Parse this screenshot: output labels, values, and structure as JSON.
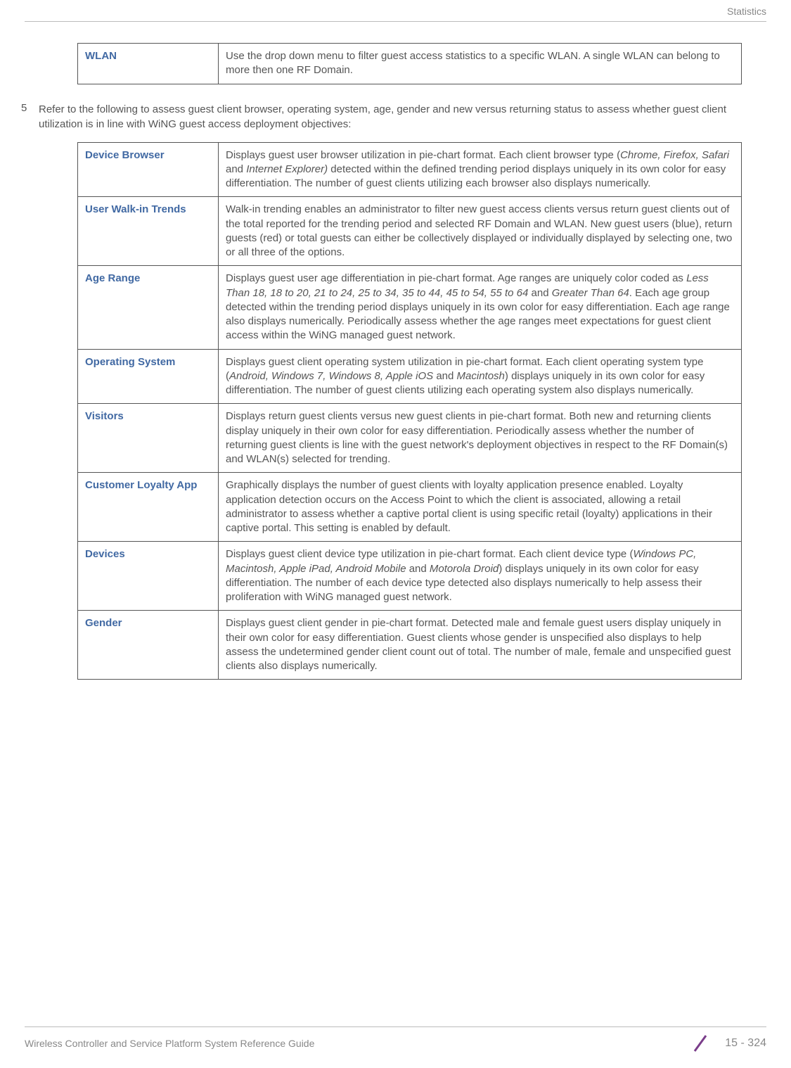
{
  "header": {
    "section": "Statistics"
  },
  "table1": {
    "rows": [
      {
        "label": "WLAN",
        "desc": "Use the drop down menu to filter guest access statistics to a specific WLAN. A single WLAN can belong to more then one RF Domain."
      }
    ]
  },
  "step": {
    "number": "5",
    "text": "Refer to the following to assess guest client browser, operating system, age, gender and new versus returning status to assess whether guest client utilization is in line with WiNG guest access deployment objectives:"
  },
  "table2": {
    "rows": [
      {
        "label": "Device Browser",
        "desc_parts": [
          {
            "t": "Displays guest user browser utilization in pie-chart format. Each client browser type ("
          },
          {
            "t": "Chrome, Firefox, Safari",
            "i": true
          },
          {
            "t": " and "
          },
          {
            "t": "Internet Explorer)",
            "i": true
          },
          {
            "t": " detected within the defined trending period displays uniquely in its own color for easy differentiation. The number of guest clients utilizing each browser also displays numerically."
          }
        ]
      },
      {
        "label": "User Walk-in Trends",
        "desc_parts": [
          {
            "t": "Walk-in trending enables an administrator to filter new guest access clients versus return guest clients out of the total reported for the trending period and selected RF Domain and WLAN. New guest users (blue), return guests (red) or total guests can either be collectively displayed or individually displayed by selecting one, two or all three of the options."
          }
        ]
      },
      {
        "label": "Age Range",
        "desc_parts": [
          {
            "t": "Displays guest user age differentiation in pie-chart format. Age ranges are uniquely color coded as "
          },
          {
            "t": "Less Than 18, 18 to 20, 21 to 24, 25 to 34, 35 to 44, 45 to 54, 55 to 64",
            "i": true
          },
          {
            "t": " and "
          },
          {
            "t": "Greater Than 64",
            "i": true
          },
          {
            "t": ". Each age group detected within the trending period displays uniquely in its own color for easy differentiation. Each age range also displays numerically. Periodically assess whether the age ranges meet expectations for guest client access within the WiNG managed guest network."
          }
        ]
      },
      {
        "label": "Operating System",
        "desc_parts": [
          {
            "t": "Displays guest client operating system utilization in pie-chart format. Each client operating system type ("
          },
          {
            "t": "Android, Windows 7, Windows 8, Apple iOS",
            "i": true
          },
          {
            "t": " and "
          },
          {
            "t": "Macintosh",
            "i": true
          },
          {
            "t": ") displays uniquely in its own color for easy differentiation. The number of guest clients utilizing each operating system also displays numerically."
          }
        ]
      },
      {
        "label": "Visitors",
        "desc_parts": [
          {
            "t": "Displays return guest clients versus new guest clients in pie-chart format. Both new and returning clients display uniquely in their own color for easy differentiation. Periodically assess whether the number of returning guest clients is line with the guest network's deployment objectives in respect to the RF Domain(s) and WLAN(s) selected for trending."
          }
        ]
      },
      {
        "label": "Customer Loyalty App",
        "desc_parts": [
          {
            "t": "Graphically displays the number of guest clients with loyalty application presence enabled. Loyalty application detection occurs on the Access Point to which the client is associated, allowing a retail administrator to assess whether a captive portal client is using specific retail (loyalty) applications in their captive portal. This setting is enabled by default."
          }
        ]
      },
      {
        "label": "Devices",
        "desc_parts": [
          {
            "t": "Displays guest client device type utilization in pie-chart format. Each client device type ("
          },
          {
            "t": "Windows PC, Macintosh, Apple iPad, Android Mobile",
            "i": true
          },
          {
            "t": " and "
          },
          {
            "t": "Motorola Droid",
            "i": true
          },
          {
            "t": ") displays uniquely in its own color for easy differentiation. The number of each device type detected also displays numerically to help assess their proliferation with WiNG managed guest network."
          }
        ]
      },
      {
        "label": "Gender",
        "desc_parts": [
          {
            "t": "Displays guest client gender in pie-chart format. Detected male and female guest users display uniquely in their own color for easy differentiation. Guest clients whose gender is unspecified also displays to help assess the undetermined gender client count out of total. The number of male, female and unspecified guest clients also displays numerically."
          }
        ]
      }
    ]
  },
  "footer": {
    "left": "Wireless Controller and Service Platform System Reference Guide",
    "page": "15 - 324"
  }
}
